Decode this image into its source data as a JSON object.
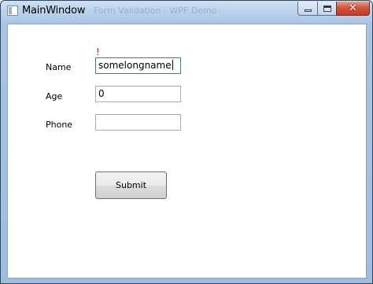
{
  "window": {
    "title": "MainWindow",
    "title_ghost": "Form Validation - WPF Demo",
    "icons": {
      "app": "window-app-icon",
      "minimize": "minimize-icon",
      "maximize": "maximize-icon",
      "close": "close-icon"
    }
  },
  "form": {
    "error_indicator": "!",
    "name_label": "Name",
    "name_value": "somelongname",
    "age_label": "Age",
    "age_value": "0",
    "phone_label": "Phone",
    "phone_value": "",
    "submit_label": "Submit"
  },
  "colors": {
    "error": "#ff0000",
    "focus_border": "#3d7bad",
    "close_button": "#c63a22"
  }
}
